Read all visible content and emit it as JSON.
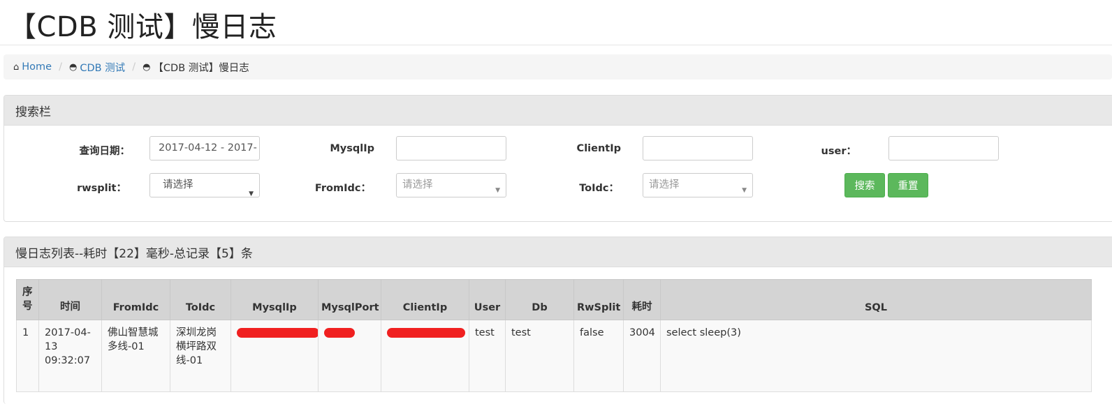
{
  "page": {
    "title": "【CDB 测试】慢日志"
  },
  "breadcrumb": {
    "items": [
      {
        "icon": "home-icon",
        "label": "Home"
      },
      {
        "icon": "dashboard-icon",
        "label": "CDB 测试"
      },
      {
        "icon": "dashboard-icon",
        "label": "【CDB 测试】慢日志"
      }
    ],
    "separator": "/"
  },
  "search": {
    "heading": "搜索栏",
    "date_label": "查询日期：",
    "date_value": "2017-04-12 - 2017-",
    "mysqlip_label": "MysqlIp",
    "clientip_label": "ClientIp",
    "user_label": "user：",
    "rwsplit_label": "rwsplit：",
    "rwsplit_value": "请选择",
    "fromidc_label": "FromIdc：",
    "fromidc_placeholder": "请选择",
    "toidc_label": "ToIdc：",
    "toidc_placeholder": "请选择",
    "search_button": "搜索",
    "reset_button": "重置"
  },
  "list": {
    "heading": "慢日志列表--耗时【22】毫秒-总记录【5】条",
    "columns": [
      "序号",
      "时间",
      "FromIdc",
      "ToIdc",
      "MysqlIp",
      "MysqlPort",
      "ClientIp",
      "User",
      "Db",
      "RwSplit",
      "耗时",
      "SQL"
    ],
    "rows": [
      {
        "no": "1",
        "time": "2017-04-13 09:32:07",
        "fromidc": "佛山智慧城多线-01",
        "toidc": "深圳龙岗横坪路双线-01",
        "mysqlip": "",
        "mysqlport": "",
        "clientip": "",
        "user": "test",
        "db": "test",
        "rwsplit": "false",
        "duration": "3004",
        "sql": "select sleep(3)"
      }
    ]
  },
  "colors": {
    "link": "#337ab7",
    "success": "#5cb85c",
    "redaction": "#f02020"
  }
}
